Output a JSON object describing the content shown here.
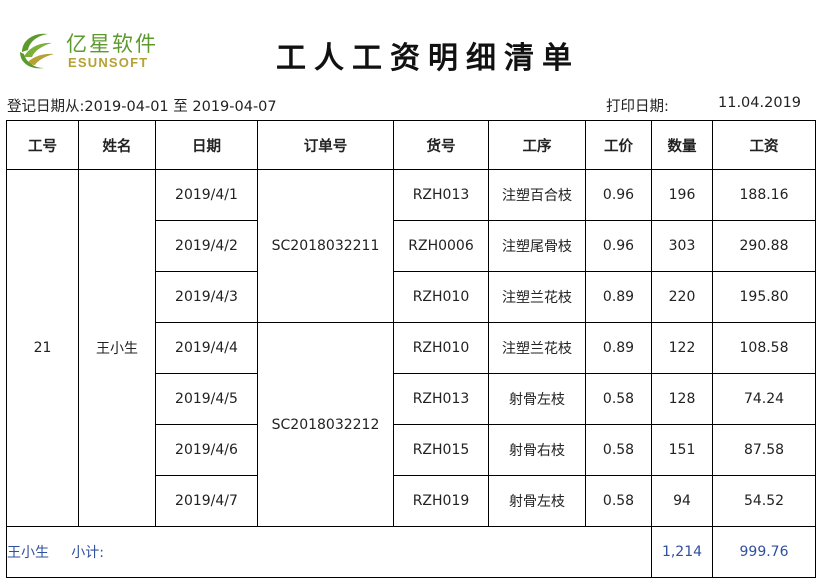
{
  "header": {
    "logo_cn": "亿星软件",
    "logo_en": "ESUNSOFT",
    "title": "工人工资明细清单",
    "logo_colors": [
      "#5d9a2e",
      "#b5a135"
    ]
  },
  "info": {
    "date_range": "登记日期从:2019-04-01 至 2019-04-07",
    "print_label": "打印日期:",
    "print_value": "11.04.2019"
  },
  "table": {
    "columns": [
      "工号",
      "姓名",
      "日期",
      "订单号",
      "货号",
      "工序",
      "工价",
      "数量",
      "工资"
    ],
    "worker_id": "21",
    "worker_name": "王小生",
    "orders": [
      "SC2018032211",
      "SC2018032212"
    ],
    "rows": [
      {
        "date": "2019/4/1",
        "item": "RZH013",
        "process": "注塑百合枝",
        "price": "0.96",
        "qty": "196",
        "wage": "188.16"
      },
      {
        "date": "2019/4/2",
        "item": "RZH0006",
        "process": "注塑尾骨枝",
        "price": "0.96",
        "qty": "303",
        "wage": "290.88"
      },
      {
        "date": "2019/4/3",
        "item": "RZH010",
        "process": "注塑兰花枝",
        "price": "0.89",
        "qty": "220",
        "wage": "195.80"
      },
      {
        "date": "2019/4/4",
        "item": "RZH010",
        "process": "注塑兰花枝",
        "price": "0.89",
        "qty": "122",
        "wage": "108.58"
      },
      {
        "date": "2019/4/5",
        "item": "RZH013",
        "process": "射骨左枝",
        "price": "0.58",
        "qty": "128",
        "wage": "74.24"
      },
      {
        "date": "2019/4/6",
        "item": "RZH015",
        "process": "射骨右枝",
        "price": "0.58",
        "qty": "151",
        "wage": "87.58"
      },
      {
        "date": "2019/4/7",
        "item": "RZH019",
        "process": "射骨左枝",
        "price": "0.58",
        "qty": "94",
        "wage": "54.52"
      }
    ],
    "subtotal": {
      "name": "王小生",
      "label": "小计:",
      "qty": "1,214",
      "wage": "999.76",
      "color": "#2f4fa0"
    }
  }
}
